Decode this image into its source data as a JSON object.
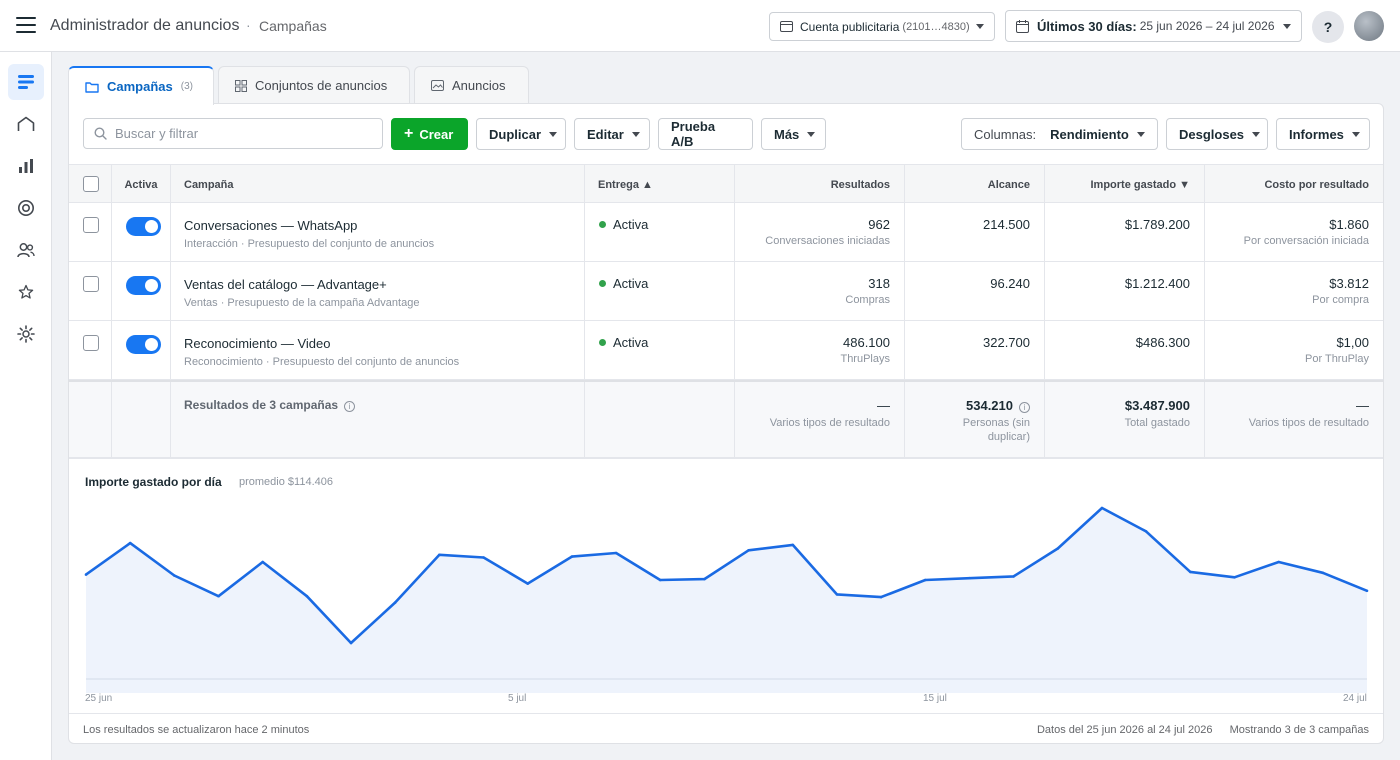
{
  "app": {
    "title": "Administrador de anuncios",
    "separator": "·",
    "crumb": "Campañas"
  },
  "account": {
    "label": "Cuenta publicitaria",
    "id": "(2101…4830)"
  },
  "date": {
    "label": "Últimos 30 días:",
    "range": "25 jun 2026 – 24 jul 2026"
  },
  "help_label": "?",
  "tabs": [
    {
      "label": "Campañas",
      "count": "(3)"
    },
    {
      "label": "Conjuntos de anuncios"
    },
    {
      "label": "Anuncios"
    }
  ],
  "toolbar": {
    "search_placeholder": "Buscar y filtrar",
    "create": "Crear",
    "duplicate": "Duplicar",
    "edit": "Editar",
    "abtest": "Prueba A/B",
    "more": "Más",
    "columns_label": "Columnas:",
    "columns_value": "Rendimiento",
    "breakdowns": "Desgloses",
    "reports": "Informes"
  },
  "table": {
    "headers": {
      "active": "Activa",
      "campaign": "Campaña",
      "delivery": "Entrega ▲",
      "results": "Resultados",
      "reach": "Alcance",
      "spent": "Importe gastado ▼",
      "cpr": "Costo por resultado"
    },
    "rows": [
      {
        "name": "Conversaciones — WhatsApp",
        "sub": "Interacción · Presupuesto del conjunto de anuncios",
        "delivery": "Activa",
        "results": "962",
        "results_sub": "Conversaciones iniciadas",
        "reach": "214.500",
        "spent": "$1.789.200",
        "cpr": "$1.860",
        "cpr_sub": "Por conversación iniciada"
      },
      {
        "name": "Ventas del catálogo — Advantage+",
        "sub": "Ventas · Presupuesto de la campaña Advantage",
        "delivery": "Activa",
        "results": "318",
        "results_sub": "Compras",
        "reach": "96.240",
        "spent": "$1.212.400",
        "cpr": "$3.812",
        "cpr_sub": "Por compra"
      },
      {
        "name": "Reconocimiento — Video",
        "sub": "Reconocimiento · Presupuesto del conjunto de anuncios",
        "delivery": "Activa",
        "results": "486.100",
        "results_sub": "ThruPlays",
        "reach": "322.700",
        "spent": "$486.300",
        "cpr": "$1,00",
        "cpr_sub": "Por ThruPlay"
      }
    ],
    "summary": {
      "title": "Resultados de 3 campañas",
      "results": "—",
      "results_sub": "Varios tipos de resultado",
      "reach": "534.210",
      "reach_sub": "Personas (sin duplicar)",
      "spent": "$3.487.900",
      "spent_sub": "Total gastado",
      "cpr": "—",
      "cpr_sub": "Varios tipos de resultado"
    }
  },
  "chart_data": {
    "type": "area",
    "title": "Importe gastado por día",
    "subtitle": "promedio $114.406",
    "x_ticks": [
      "25 jun",
      "5 jul",
      "15 jul",
      "24 jul"
    ],
    "values": [
      116000,
      151000,
      115000,
      92000,
      130000,
      92000,
      40000,
      85000,
      138000,
      135000,
      106000,
      136000,
      140000,
      110000,
      111000,
      143000,
      149000,
      94000,
      91000,
      110000,
      112000,
      114000,
      145000,
      190000,
      164000,
      119000,
      113000,
      130000,
      118000,
      98000
    ],
    "ylim": [
      0,
      200000
    ],
    "color": "#1a6ae3",
    "fill": "#eef3fc"
  },
  "footer": {
    "updated": "Los resultados se actualizaron hace 2 minutos",
    "data_range": "Datos del 25 jun 2026 al 24 jul 2026",
    "showing": "Mostrando 3 de 3 campañas"
  }
}
